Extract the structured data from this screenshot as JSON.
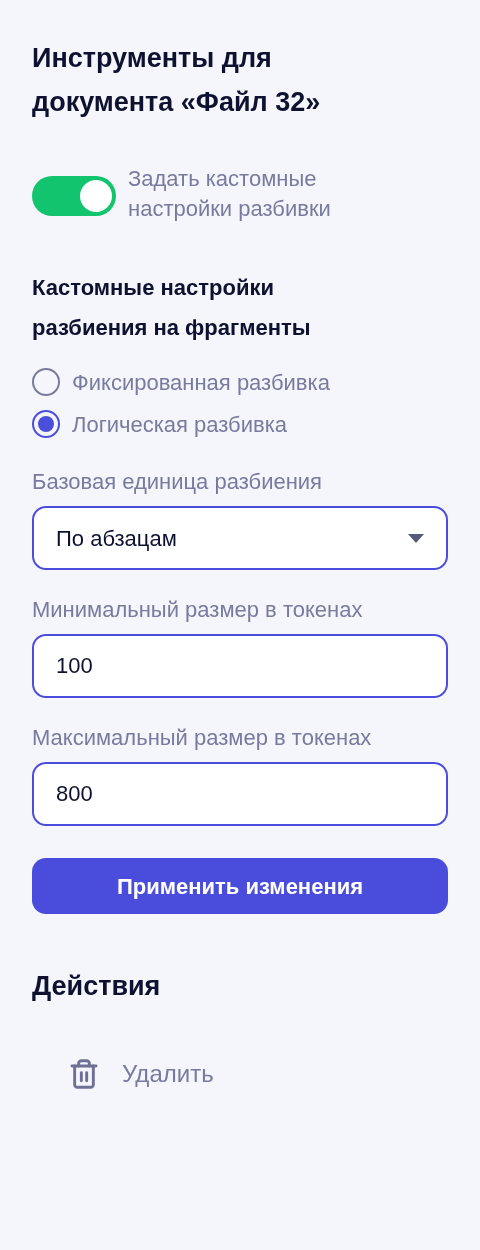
{
  "title": "Инструменты для документа «Файл 32»",
  "custom_toggle": {
    "label": "Задать кастомные настройки разбивки",
    "on": true
  },
  "section_title": "Кастомные настройки разбиения на фрагменты",
  "split_modes": [
    {
      "label": "Фиксированная разбивка",
      "selected": false
    },
    {
      "label": "Логическая разбивка",
      "selected": true
    }
  ],
  "fields": [
    {
      "kind": "select",
      "label": "Базовая единица разбиения",
      "value": "По абзацам"
    },
    {
      "kind": "input",
      "label": "Минимальный размер в токенах",
      "value": "100"
    },
    {
      "kind": "input",
      "label": "Максимальный размер в токенах",
      "value": "800"
    }
  ],
  "apply_button": "Применить изменения",
  "actions": {
    "title": "Действия",
    "items": [
      {
        "label": "Удалить"
      }
    ]
  }
}
